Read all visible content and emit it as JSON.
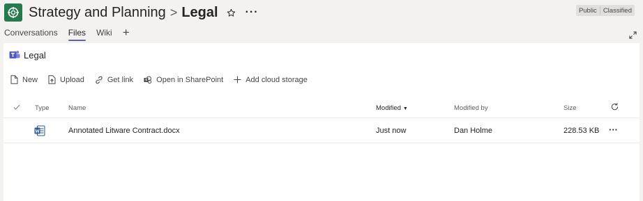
{
  "header": {
    "team_name": "Strategy and Planning",
    "separator": ">",
    "channel_name": "Legal",
    "more_label": "···",
    "badges": [
      "Public",
      "Classified"
    ]
  },
  "tabs": [
    {
      "label": "Conversations",
      "active": false
    },
    {
      "label": "Files",
      "active": true
    },
    {
      "label": "Wiki",
      "active": false
    }
  ],
  "add_tab_label": "+",
  "library": {
    "title": "Legal"
  },
  "commands": [
    {
      "label": "New",
      "icon": "new-doc-icon"
    },
    {
      "label": "Upload",
      "icon": "upload-icon"
    },
    {
      "label": "Get link",
      "icon": "link-icon"
    },
    {
      "label": "Open in SharePoint",
      "icon": "sharepoint-icon"
    },
    {
      "label": "Add cloud storage",
      "icon": "plus-icon"
    }
  ],
  "columns": {
    "type": "Type",
    "name": "Name",
    "modified": "Modified",
    "modified_by": "Modified by",
    "size": "Size"
  },
  "files": [
    {
      "name": "Annotated Litware Contract.docx",
      "modified": "Just now",
      "modified_by": "Dan Holme",
      "size": "228.53 KB",
      "type_icon": "word-icon",
      "more_label": "···"
    }
  ],
  "colors": {
    "accent": "#6264a7",
    "team_avatar": "#237b4b",
    "word_blue": "#2b579a"
  }
}
